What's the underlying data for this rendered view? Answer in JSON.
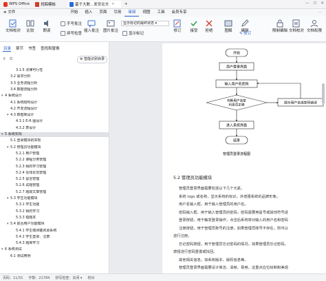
{
  "titlebar": {
    "app_title": "WPS Office",
    "tabs": [
      "找稿模板",
      "基于大数...发安论文"
    ],
    "new_tab": "+"
  },
  "menubar": {
    "items": [
      "≡ 文件",
      "开始",
      "插入",
      "页面",
      "引用",
      "审阅",
      "视图",
      "工具",
      "会员专享"
    ],
    "active_index": 5
  },
  "toolbar": {
    "buttons_large": [
      "文档校对",
      "比较",
      "朗读",
      "拼写检查",
      "字数统计",
      "插入批注",
      "图片批注",
      "显示标记的最终状态",
      "显示标记",
      "修订",
      "接受",
      "拒绝",
      "图解",
      "编辑",
      "限制编辑",
      "文档校对",
      "文档权限"
    ],
    "select_value": "显示标记的最终状态",
    "handwrite": "手写批注",
    "pen": "✎ 修订"
  },
  "navpanel": {
    "tabs": [
      "目录",
      "章节",
      "书签",
      "查找和替换"
    ],
    "active_tab": 0,
    "smart_toc": "智能识别目录",
    "items": [
      {
        "text": "3.1.5 法律可行性",
        "indent": 3,
        "arrow": ""
      },
      {
        "text": "3.2 需求分析",
        "indent": 2,
        "arrow": ""
      },
      {
        "text": "3.3 业务流程分析",
        "indent": 2,
        "arrow": ""
      },
      {
        "text": "3.4 数据流程分析",
        "indent": 2,
        "arrow": ""
      },
      {
        "text": "4 系统设计",
        "indent": 1,
        "arrow": "▾"
      },
      {
        "text": "4.1 系统结构设计",
        "indent": 2,
        "arrow": ""
      },
      {
        "text": "4.2 开发流程设计",
        "indent": 2,
        "arrow": ""
      },
      {
        "text": "4.3 数据库设计",
        "indent": 2,
        "arrow": "▾"
      },
      {
        "text": "4.3.1 E-R 图设计",
        "indent": 3,
        "arrow": ""
      },
      {
        "text": "4.3.2 表设计",
        "indent": 3,
        "arrow": ""
      },
      {
        "text": "5 系统实现",
        "indent": 1,
        "arrow": "▾"
      },
      {
        "text": "5.1 登录模块的实现",
        "indent": 2,
        "arrow": ""
      },
      {
        "text": "5.2 管理员功能模块",
        "indent": 2,
        "arrow": "▾"
      },
      {
        "text": "5.2.1 用户管理",
        "indent": 3,
        "arrow": ""
      },
      {
        "text": "5.2.2 课程分类管理",
        "indent": 3,
        "arrow": ""
      },
      {
        "text": "5.2.3 我的学习管理",
        "indent": 3,
        "arrow": ""
      },
      {
        "text": "5.2.4 在线论坛管理",
        "indent": 3,
        "arrow": ""
      },
      {
        "text": "5.2.5 留言管理",
        "indent": 3,
        "arrow": ""
      },
      {
        "text": "5.2.6 试题管理",
        "indent": 3,
        "arrow": ""
      },
      {
        "text": "5.2.7 题故文章管理",
        "indent": 3,
        "arrow": ""
      },
      {
        "text": "5.3 学生功能模块",
        "indent": 2,
        "arrow": "▾"
      },
      {
        "text": "5.3.1 学生功能",
        "indent": 3,
        "arrow": ""
      },
      {
        "text": "5.3.2 我的学习",
        "indent": 3,
        "arrow": ""
      },
      {
        "text": "5.3.3 错题本",
        "indent": 3,
        "arrow": ""
      },
      {
        "text": "5.4 前台用户功能模块",
        "indent": 2,
        "arrow": "▾"
      },
      {
        "text": "5.4.1 学生端诗塞资源系统",
        "indent": 3,
        "arrow": ""
      },
      {
        "text": "5.4.2 学生登录、注册",
        "indent": 3,
        "arrow": ""
      },
      {
        "text": "5.4.3 题库学习",
        "indent": 3,
        "arrow": ""
      },
      {
        "text": "6 系统测试",
        "indent": 1,
        "arrow": "▾"
      },
      {
        "text": "6.1 测试用例",
        "indent": 2,
        "arrow": ""
      }
    ],
    "selected_index": 10
  },
  "flowchart": {
    "start": "开始",
    "login_page": "用户登录界面",
    "input": "输入用户名密码",
    "decision": "判断用户名密码是否正确",
    "error": "提示用户名或密码错误",
    "enter": "进入系统界面",
    "end": "结束",
    "yes": "是",
    "no": "否",
    "caption": "管理员登录流程图"
  },
  "doc": {
    "heading": "5.2 管理员功能模块",
    "lines": [
      "管理员登录界面需要包括以下几个元素。",
      "系统 logo 或名称，显示系统的标识，并增强系统的品牌形象。",
      "用户名输入框，用于输入管理员的用户名。",
      "密码输入框，用于输入管理员的密码，密码需要用星号或其他符号进",
      "登录按钮，用于触发登录操作，点击后系统将对输入的用户名和密码",
      "注册按钮，用于管理员账号的注册，如果管理员账号不存在，则可以",
      "进行注册。",
      "忘记密码按钮，用于管理员忘记密码的情况，如果管理员忘记密码，",
      "按钮进行密码重置或找回。",
      "其他相关信息，如系统版本、版权信息等。",
      "管理员登录界面需要设计简洁、清晰、易用，这重点应位绘制和美观"
    ]
  },
  "statusbar": {
    "page": "页码：11/31",
    "words": "字数：21784",
    "spell": "拼写检查：关闭 ▾",
    "proof": "校对"
  }
}
